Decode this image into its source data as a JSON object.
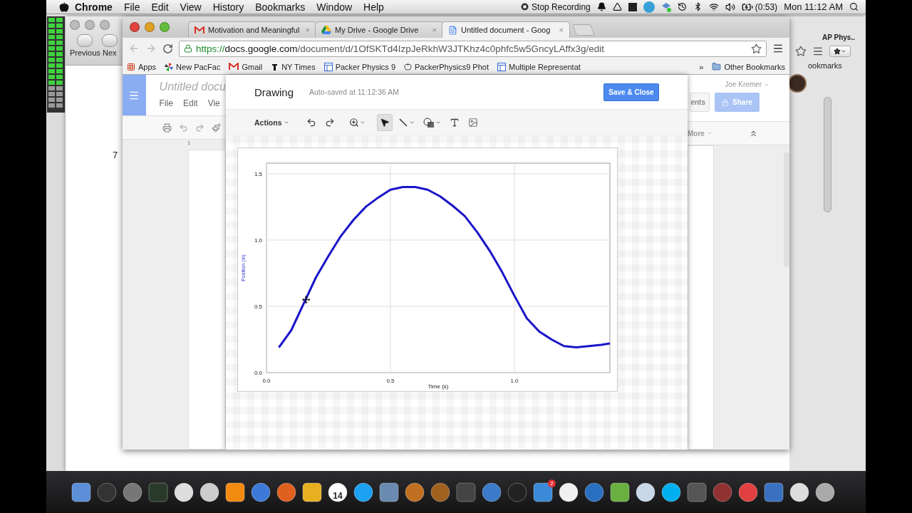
{
  "menu_bar": {
    "app": "Chrome",
    "menus": [
      "File",
      "Edit",
      "View",
      "History",
      "Bookmarks",
      "Window",
      "Help"
    ],
    "recording": "Stop Recording",
    "battery": "(0:53)",
    "clock": "Mon 11:12 AM"
  },
  "back_window": {
    "buttons": [
      "Previous",
      "Nex"
    ],
    "page_number": "7",
    "tab_title": "AP Phys..",
    "bookmarks_label": "ookmarks"
  },
  "browser": {
    "tabs": [
      {
        "title": "Motivation and Meaningful",
        "kind": "gmail",
        "selected": false,
        "close": "×"
      },
      {
        "title": "My Drive - Google Drive",
        "kind": "drive",
        "selected": false,
        "close": "×"
      },
      {
        "title": "Untitled document - Goog",
        "kind": "docs",
        "selected": true,
        "close": "×"
      }
    ],
    "url": {
      "scheme": "https://",
      "host": "docs.google.com",
      "path": "/document/d/1OfSKTd4IzpJeRkhW3JTKhz4c0phfc5w5GncyLAffx3g/edit"
    },
    "bookmarks": [
      {
        "label": "Apps",
        "kind": "apps"
      },
      {
        "label": "New PacFac",
        "kind": "pinwheel"
      },
      {
        "label": "Gmail",
        "kind": "gmail"
      },
      {
        "label": "NY Times",
        "kind": "nyt"
      },
      {
        "label": "Packer Physics 9",
        "kind": "page"
      },
      {
        "label": "PackerPhysics9 Phot",
        "kind": "apple"
      },
      {
        "label": "Multiple Representat",
        "kind": "page"
      }
    ],
    "more_bookmarks": "»",
    "other_bookmarks": "Other Bookmarks"
  },
  "document": {
    "title": "Untitled docu",
    "menus": [
      "File",
      "Edit",
      "Vie"
    ],
    "ruler_mark": "1",
    "user": "Joe Kremer",
    "comments": "ents",
    "share": "Share",
    "more": "More"
  },
  "drawing": {
    "title": "Drawing",
    "status": "Auto-saved at 11:12:36 AM",
    "save": "Save & Close",
    "actions": "Actions",
    "tools": [
      {
        "kind": "undo",
        "selected": false
      },
      {
        "kind": "redo",
        "selected": false
      },
      {
        "kind": "zoom",
        "selected": false
      },
      {
        "kind": "select",
        "selected": true
      },
      {
        "kind": "line",
        "selected": false
      },
      {
        "kind": "shape",
        "selected": false
      },
      {
        "kind": "textbox",
        "selected": false
      },
      {
        "kind": "image",
        "selected": false
      }
    ],
    "chart_data": {
      "type": "line",
      "grid": true,
      "xlabel": "Time (s)",
      "ylabel": "Position (m)",
      "x": [
        0.05,
        0.1,
        0.15,
        0.2,
        0.25,
        0.3,
        0.35,
        0.4,
        0.45,
        0.5,
        0.55,
        0.6,
        0.65,
        0.7,
        0.75,
        0.8,
        0.85,
        0.9,
        0.95,
        1.0,
        1.05,
        1.1,
        1.15,
        1.2,
        1.25,
        1.3,
        1.35,
        1.385
      ],
      "series": [
        {
          "color": "#1a14c8",
          "values": [
            0.19,
            0.32,
            0.52,
            0.72,
            0.88,
            1.03,
            1.15,
            1.25,
            1.32,
            1.38,
            1.4,
            1.4,
            1.38,
            1.33,
            1.26,
            1.18,
            1.06,
            0.92,
            0.76,
            0.58,
            0.41,
            0.31,
            0.25,
            0.2,
            0.19,
            0.2,
            0.21,
            0.22
          ]
        }
      ],
      "xlim": [
        0,
        1.385
      ],
      "ylim": [
        0,
        1.58
      ],
      "xticks": [
        {
          "value": 0,
          "label": "0.0"
        },
        {
          "value": 0.5,
          "label": "0.5"
        },
        {
          "value": 1,
          "label": "1.0"
        }
      ],
      "yticks": [
        {
          "value": 0,
          "label": "0.0"
        },
        {
          "value": 0.5,
          "label": "0.5"
        },
        {
          "value": 1,
          "label": "1.0"
        },
        {
          "value": 1.5,
          "label": "1.5"
        }
      ]
    }
  },
  "dock": {
    "calendar_day": "14",
    "badge": "2"
  }
}
